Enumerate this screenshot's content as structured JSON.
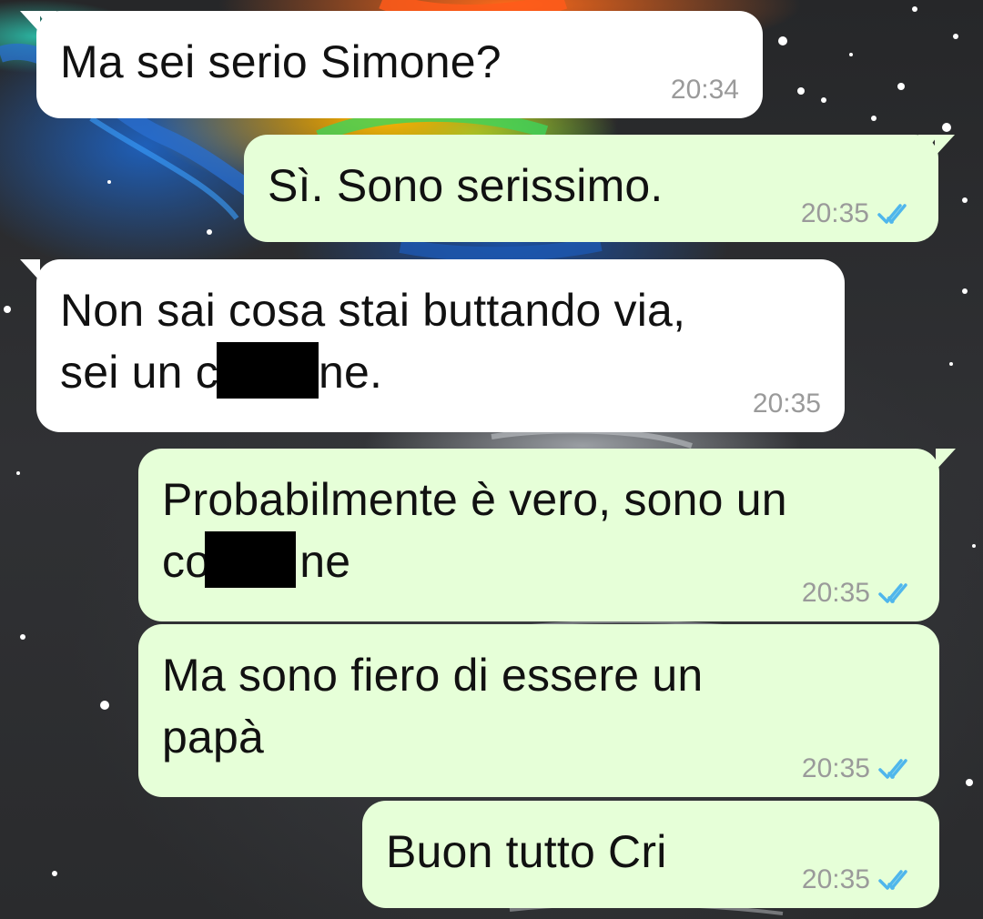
{
  "conversation": {
    "messages": [
      {
        "direction": "incoming",
        "text": "Ma sei serio Simone?",
        "time": "20:34"
      },
      {
        "direction": "outgoing",
        "text": "Sì. Sono serissimo.",
        "time": "20:35",
        "status": "read"
      },
      {
        "direction": "incoming",
        "line1": "Non sai cosa stai buttando via,",
        "line2_start": "sei un co",
        "line2_end": "ne.",
        "time": "20:35",
        "redacted": true
      },
      {
        "direction": "outgoing",
        "line1": "Probabilmente è vero, sono un",
        "line2_start": "co",
        "line2_end": "ne",
        "time": "20:35",
        "status": "read",
        "redacted": true
      },
      {
        "direction": "outgoing",
        "line1": "Ma sono fiero di essere un",
        "line2": "papà",
        "time": "20:35",
        "status": "read"
      },
      {
        "direction": "outgoing",
        "text": "Buon tutto Cri",
        "time": "20:35",
        "status": "read"
      }
    ]
  },
  "colors": {
    "incoming_bubble": "#ffffff",
    "outgoing_bubble": "#e6ffd8",
    "read_ticks": "#4fb6ec",
    "timestamp": "#9a9a9a"
  },
  "icons": {
    "read_receipt": "double-check-icon",
    "redaction": "black-redaction-box"
  }
}
